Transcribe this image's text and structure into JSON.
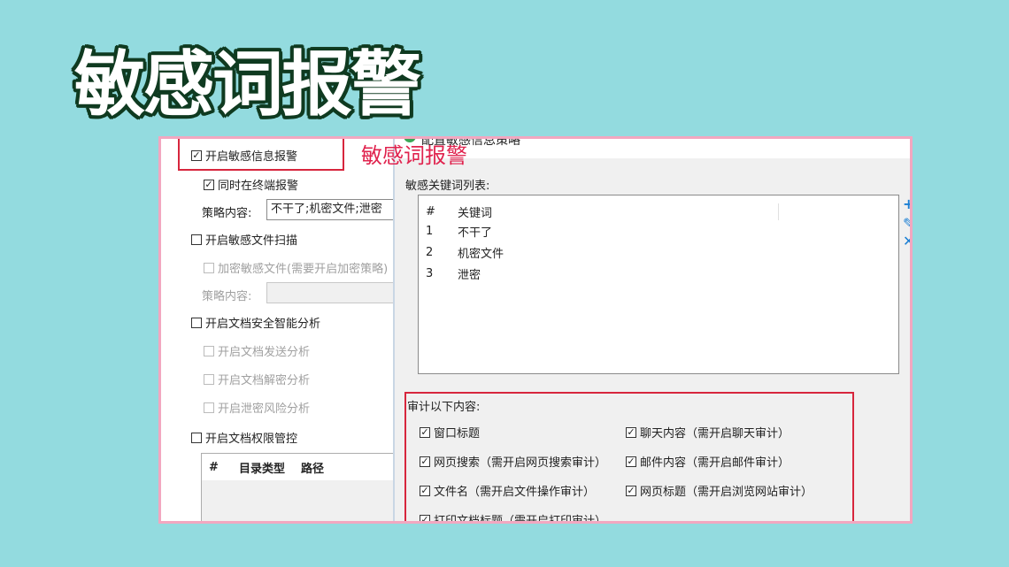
{
  "heading": "敏感词报警",
  "annotation": "敏感词报警",
  "colors": {
    "background": "#93dbdf",
    "frame_border": "#f2a7c0",
    "highlight": "#d7263d",
    "annotation_text": "#e0234e",
    "icon_blue": "#1a7fd4"
  },
  "left": {
    "enable_sensitive_alarm": {
      "label": "开启敏感信息报警",
      "checked": true
    },
    "terminal_alarm": {
      "label": "同时在终端报警",
      "checked": true
    },
    "strategy_label": "策略内容:",
    "strategy_value": "不干了;机密文件;泄密",
    "enable_file_scan": {
      "label": "开启敏感文件扫描",
      "checked": false
    },
    "encrypt_sensitive": {
      "label": "加密敏感文件(需要开启加密策略)",
      "checked": false
    },
    "strategy_label_2": "策略内容:",
    "strategy_value_2": "",
    "enable_doc_analysis": {
      "label": "开启文档安全智能分析",
      "checked": false
    },
    "doc_send": {
      "label": "开启文档发送分析",
      "checked": false
    },
    "doc_decrypt": {
      "label": "开启文档解密分析",
      "checked": false
    },
    "leak_risk": {
      "label": "开启泄密风险分析",
      "checked": false
    },
    "doc_permission": {
      "label": "开启文档权限管控",
      "checked": false
    },
    "dir_table": {
      "columns": [
        "#",
        "目录类型",
        "路径"
      ]
    }
  },
  "right": {
    "dialog_title": "配置敏感信息策略",
    "keyword_list_label": "敏感关键词列表:",
    "keyword_table": {
      "columns": [
        "#",
        "关键词"
      ],
      "rows": [
        {
          "index": "1",
          "keyword": "不干了"
        },
        {
          "index": "2",
          "keyword": "机密文件"
        },
        {
          "index": "3",
          "keyword": "泄密"
        }
      ]
    },
    "side_icons": [
      "plus-icon",
      "edit-icon",
      "delete-icon"
    ],
    "audit_label": "审计以下内容:",
    "audit_items": [
      {
        "label": "窗口标题",
        "checked": true
      },
      {
        "label": "聊天内容（需开启聊天审计）",
        "checked": true
      },
      {
        "label": "网页搜索（需开启网页搜索审计）",
        "checked": true
      },
      {
        "label": "邮件内容（需开启邮件审计）",
        "checked": true
      },
      {
        "label": "文件名（需开启文件操作审计）",
        "checked": true
      },
      {
        "label": "网页标题（需开启浏览网站审计）",
        "checked": true
      },
      {
        "label": "打印文档标题（需开启打印审计）",
        "checked": true
      }
    ]
  }
}
